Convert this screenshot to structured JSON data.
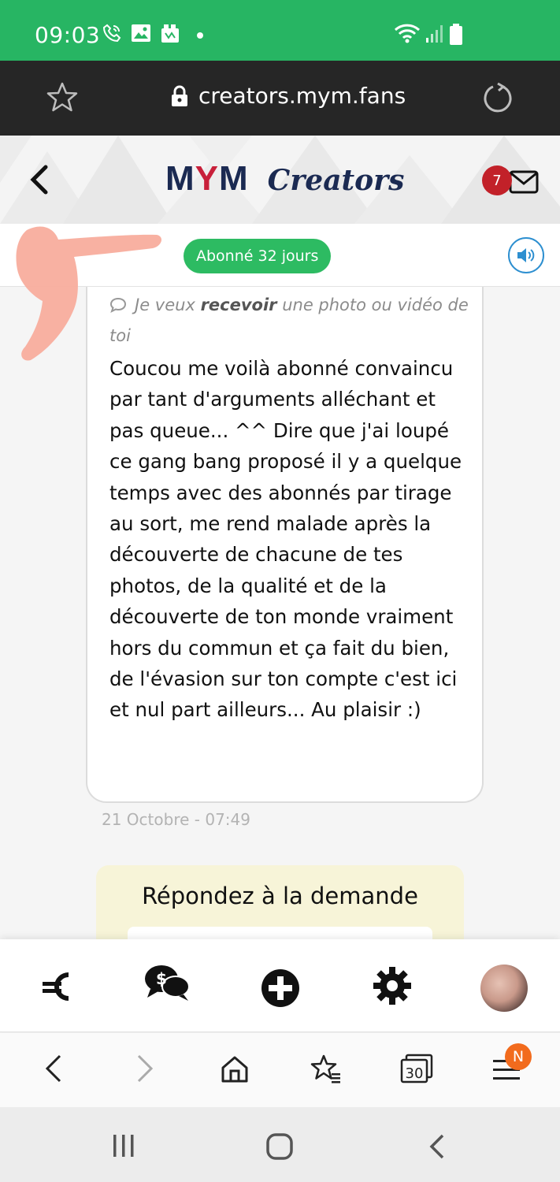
{
  "status_bar": {
    "time": "09:03",
    "icons": [
      "phone-call-icon",
      "gallery-icon",
      "app-notification-icon",
      "dot-icon",
      "wifi-icon",
      "signal-icon",
      "battery-icon"
    ],
    "color": "#27b563"
  },
  "browser": {
    "url": "creators.mym.fans",
    "icons": [
      "bookmark-star-icon",
      "lock-icon",
      "reload-icon"
    ]
  },
  "header": {
    "logo_part1": "MYM",
    "logo_part2": "Creators",
    "unread_count": "7",
    "icons": [
      "back-chevron-icon",
      "mail-icon"
    ]
  },
  "subscriber": {
    "badge": "Abonné 32 jours",
    "badge_color": "#2dbb62",
    "icons": [
      "sound-icon"
    ]
  },
  "message": {
    "request_prefix": "Je veux ",
    "request_bold": "recevoir",
    "request_suffix": " une photo ou vidéo de toi",
    "body": "Coucou me voilà abonné convaincu par tant d'arguments alléchant et pas queue... ^^ Dire que j'ai loupé ce gang bang proposé il y a quelque temps avec des abonnés par tirage au sort, me rend malade après la découverte de chacune de tes photos, de la qualité et de la découverte de ton monde vraiment hors du commun et ça fait du bien, de l'évasion sur ton compte c'est ici et nul part ailleurs... Au plaisir :)",
    "timestamp": "21 Octobre - 07:49"
  },
  "reply": {
    "title": "Répondez à la demande"
  },
  "app_nav": {
    "icons": [
      "euro-icon",
      "dollar-chat-icon",
      "add-circle-icon",
      "settings-gear-icon",
      "profile-avatar"
    ]
  },
  "browser_nav": {
    "tabs_count": "30",
    "menu_badge": "N",
    "icons": [
      "back-icon",
      "forward-icon",
      "home-icon",
      "bookmarks-icon",
      "tabs-icon",
      "menu-icon"
    ]
  },
  "system_nav": {
    "icons": [
      "recents-icon",
      "home-circle-icon",
      "back-system-icon"
    ]
  }
}
